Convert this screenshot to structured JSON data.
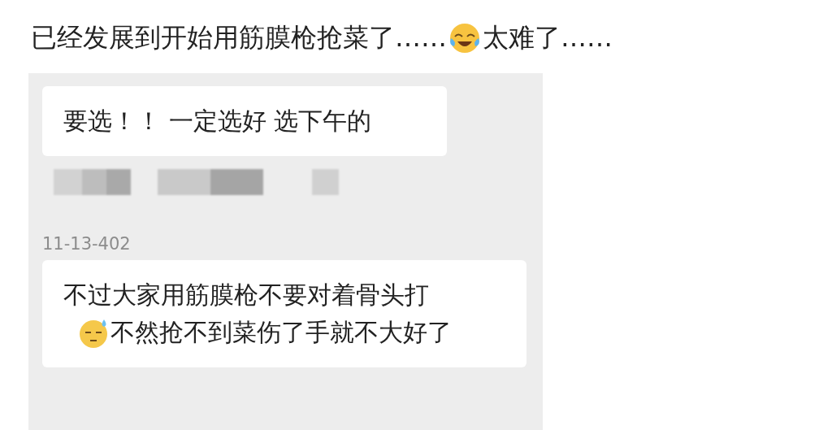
{
  "post": {
    "caption_before": "已经发展到开始用筋膜枪抢菜了……",
    "caption_after": "太难了……"
  },
  "chat": {
    "messages": [
      {
        "kind": "bubble",
        "lines": [
          "要选！！ 一定选好 选下午的"
        ]
      },
      {
        "kind": "blurred"
      },
      {
        "kind": "sender",
        "name": "11-13-402"
      },
      {
        "kind": "bubble",
        "lines": [
          "不过大家用筋膜枪不要对着骨头打",
          "不然抢不到菜伤了手就不大好了"
        ]
      }
    ]
  }
}
